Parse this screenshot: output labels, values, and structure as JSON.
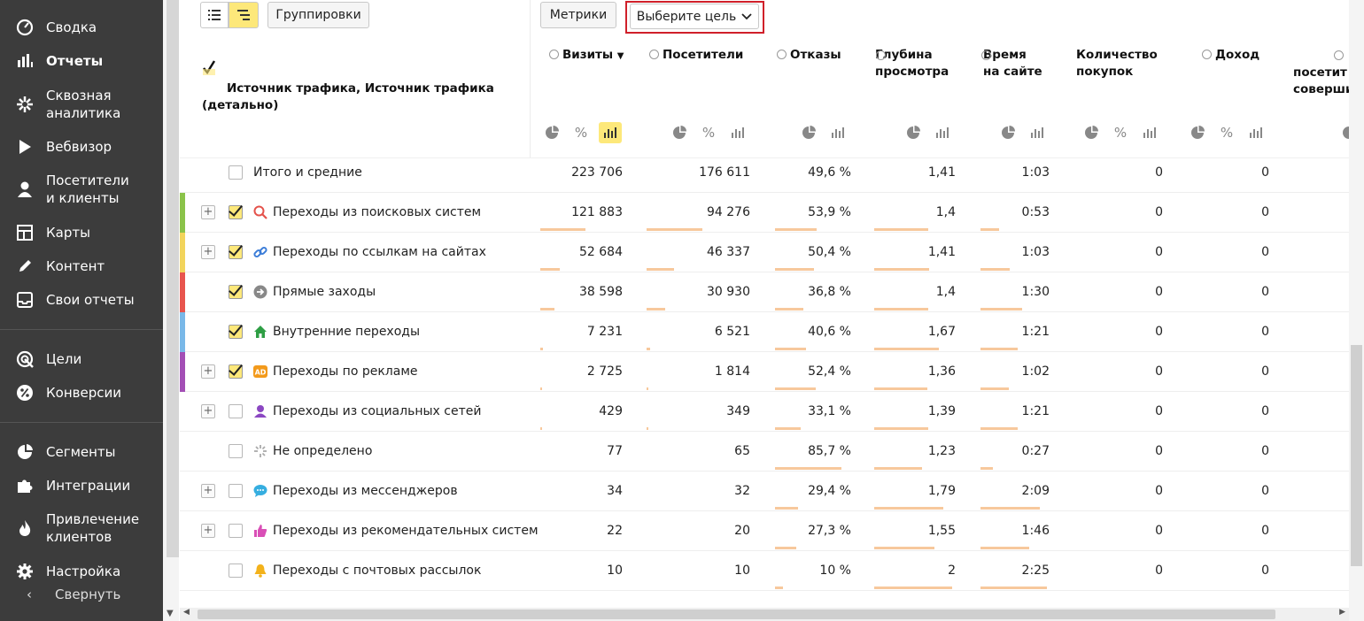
{
  "sidebar": {
    "items": [
      {
        "label": "Сводка",
        "icon": "dashboard-icon"
      },
      {
        "label": "Отчеты",
        "icon": "reports-icon"
      },
      {
        "label": "Сквозная\nаналитика",
        "icon": "crossanalytics-icon"
      },
      {
        "label": "Вебвизор",
        "icon": "play-icon"
      },
      {
        "label": "Посетители\nи клиенты",
        "icon": "user-icon"
      },
      {
        "label": "Карты",
        "icon": "maps-icon"
      },
      {
        "label": "Контент",
        "icon": "pencil-icon"
      },
      {
        "label": "Свои отчеты",
        "icon": "inbox-icon"
      },
      {
        "label": "Цели",
        "icon": "target-icon"
      },
      {
        "label": "Конверсии",
        "icon": "percent-icon"
      },
      {
        "label": "Сегменты",
        "icon": "pie-icon"
      },
      {
        "label": "Интеграции",
        "icon": "puzzle-icon"
      },
      {
        "label": "Привлечение\nклиентов",
        "icon": "fire-icon"
      },
      {
        "label": "Настройка",
        "icon": "gear-icon"
      }
    ],
    "collapse_label": "Свернуть"
  },
  "toolbar": {
    "groupings_label": "Группировки",
    "metrics_label": "Метрики",
    "goal_label": "Выберите цель"
  },
  "header": {
    "dimension": "Источник трафика, Источник трафика\n(детально)",
    "columns": [
      {
        "label": "Визиты",
        "sort": "▼"
      },
      {
        "label": "Посетители"
      },
      {
        "label": "Отказы"
      },
      {
        "label": "Глубина\nпросмотра"
      },
      {
        "label": "Время\nна сайте"
      },
      {
        "label": "Количество\nпокупок"
      },
      {
        "label": "Доход"
      },
      {
        "label": "посетит\nсоверши"
      }
    ]
  },
  "colors": {
    "accent": "#fde87a",
    "bar": "#f7c89c",
    "highlight": "#d0202a"
  },
  "rows": [
    {
      "name": "Итого и средние",
      "checked": false,
      "expandable": false,
      "color": "",
      "icon": "",
      "visits": "223 706",
      "visitors": "176 611",
      "bounce": "49,6 %",
      "depth": "1,41",
      "time": "1:03",
      "purchases": "0",
      "revenue": "0"
    },
    {
      "name": "Переходы из поисковых систем",
      "checked": true,
      "expandable": true,
      "color": "#8bc34a",
      "icon": "search-icon",
      "visits": "121 883",
      "visitors": "94 276",
      "bounce": "53,9 %",
      "depth": "1,4",
      "time": "0:53",
      "purchases": "0",
      "revenue": "0",
      "share": [
        0.545,
        0.534,
        0.539,
        0.667,
        0.265
      ]
    },
    {
      "name": "Переходы по ссылкам на сайтах",
      "checked": true,
      "expandable": true,
      "color": "#f2d45c",
      "icon": "link-icon",
      "visits": "52 684",
      "visitors": "46 337",
      "bounce": "50,4 %",
      "depth": "1,41",
      "time": "1:03",
      "purchases": "0",
      "revenue": "0",
      "share": [
        0.236,
        0.262,
        0.504,
        0.672,
        0.42
      ]
    },
    {
      "name": "Прямые заходы",
      "checked": true,
      "expandable": false,
      "color": "#e8554e",
      "icon": "arrow-icon",
      "visits": "38 598",
      "visitors": "30 930",
      "bounce": "36,8 %",
      "depth": "1,4",
      "time": "1:30",
      "purchases": "0",
      "revenue": "0",
      "share": [
        0.173,
        0.175,
        0.368,
        0.667,
        0.6
      ]
    },
    {
      "name": "Внутренние переходы",
      "checked": true,
      "expandable": false,
      "color": "#79b8e8",
      "icon": "home-icon",
      "visits": "7 231",
      "visitors": "6 521",
      "bounce": "40,6 %",
      "depth": "1,67",
      "time": "1:21",
      "purchases": "0",
      "revenue": "0",
      "share": [
        0.032,
        0.037,
        0.406,
        0.795,
        0.54
      ]
    },
    {
      "name": "Переходы по рекламе",
      "checked": true,
      "expandable": true,
      "color": "#a34fb5",
      "icon": "ad-icon",
      "visits": "2 725",
      "visitors": "1 814",
      "bounce": "52,4 %",
      "depth": "1,36",
      "time": "1:02",
      "purchases": "0",
      "revenue": "0",
      "share": [
        0.012,
        0.01,
        0.524,
        0.648,
        0.413
      ]
    },
    {
      "name": "Переходы из социальных сетей",
      "checked": false,
      "expandable": true,
      "color": "",
      "icon": "social-icon",
      "visits": "429",
      "visitors": "349",
      "bounce": "33,1 %",
      "depth": "1,39",
      "time": "1:21",
      "purchases": "0",
      "revenue": "0",
      "share": [
        0.002,
        0.002,
        0.331,
        0.662,
        0.54
      ]
    },
    {
      "name": "Не определено",
      "checked": false,
      "expandable": false,
      "color": "",
      "icon": "loader-icon",
      "visits": "77",
      "visitors": "65",
      "bounce": "85,7 %",
      "depth": "1,23",
      "time": "0:27",
      "purchases": "0",
      "revenue": "0",
      "share": [
        0,
        0,
        0.857,
        0.586,
        0.18
      ]
    },
    {
      "name": "Переходы из мессенджеров",
      "checked": false,
      "expandable": true,
      "color": "",
      "icon": "chat-icon",
      "visits": "34",
      "visitors": "32",
      "bounce": "29,4 %",
      "depth": "1,79",
      "time": "2:09",
      "purchases": "0",
      "revenue": "0",
      "share": [
        0,
        0,
        0.294,
        0.852,
        0.86
      ]
    },
    {
      "name": "Переходы из рекомендательных систем",
      "checked": false,
      "expandable": true,
      "color": "",
      "icon": "thumb-icon",
      "visits": "22",
      "visitors": "20",
      "bounce": "27,3 %",
      "depth": "1,55",
      "time": "1:46",
      "purchases": "0",
      "revenue": "0",
      "share": [
        0,
        0,
        0.273,
        0.738,
        0.707
      ]
    },
    {
      "name": "Переходы с почтовых рассылок",
      "checked": false,
      "expandable": false,
      "color": "",
      "icon": "bell-icon",
      "visits": "10",
      "visitors": "10",
      "bounce": "10 %",
      "depth": "2",
      "time": "2:25",
      "purchases": "0",
      "revenue": "0",
      "share": [
        0,
        0,
        0.1,
        0.952,
        0.967
      ]
    }
  ]
}
